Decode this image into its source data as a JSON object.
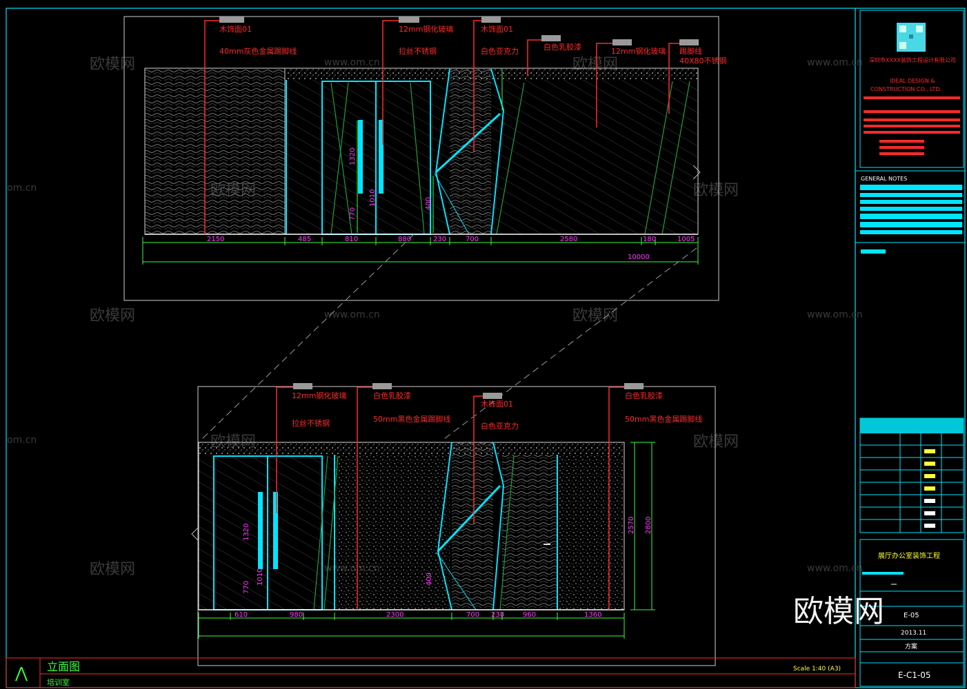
{
  "colors": {
    "background": "#000000",
    "frame": "#00e5ff",
    "annotation": "#ff2a2a",
    "dimension": "#39ff39",
    "dim_text": "#ff3cff",
    "tag": "#bdbdbd"
  },
  "watermarks": {
    "brand": "欧模网",
    "site": "www.om.cn",
    "site_short": "om.cn",
    "overlay": "欧模网"
  },
  "upper_elevation": {
    "callouts": [
      {
        "line1": "木饰面01",
        "line2": "40mm灰色金属踢脚线"
      },
      {
        "line1": "12mm钢化玻璃",
        "line2": "拉丝不锈钢"
      },
      {
        "line1": "木饰面01",
        "line2": "白色亚克力"
      },
      {
        "line1": "白色乳胶漆",
        "line2": ""
      },
      {
        "line1": "12mm钢化玻璃",
        "line2": ""
      },
      {
        "line1": "踢脚线",
        "line2": "40X80不锈钢"
      }
    ],
    "dims": [
      "2150",
      "485",
      "810",
      "880",
      "230",
      "700",
      "2580",
      "180",
      "1005"
    ],
    "total": "10000",
    "vertical_dims": [
      "1320",
      "770",
      "400",
      "1010"
    ]
  },
  "lower_elevation": {
    "callouts": [
      {
        "line1": "12mm钢化玻璃",
        "line2": "拉丝不锈钢"
      },
      {
        "line1": "白色乳胶漆",
        "line2": "50mm黑色金属踢脚线"
      },
      {
        "line1": "木饰面01",
        "line2": "白色亚克力"
      },
      {
        "line1": "白色乳胶漆",
        "line2": "50mm黑色金属踢脚线"
      }
    ],
    "dims": [
      "610",
      "980",
      "2300",
      "700",
      "230",
      "960",
      "1360"
    ],
    "vertical_dims": [
      "2570",
      "2800",
      "1320",
      "770",
      "1010",
      "400"
    ]
  },
  "title_strip": {
    "title": "立面图",
    "subtitle": "培训室",
    "scale": "Scale 1:40 (A3)"
  },
  "title_block": {
    "company_cn": "深圳市XXXX装饰工程设计有限公司",
    "company_en_1": "IDEAL DESIGN &",
    "company_en_2": "CONSTRUCTION CO., LTD.",
    "notes_heading": "GENERAL NOTES",
    "project_name": "展厅办公室装饰工程",
    "drawing_no": "E-C1-05",
    "sheet_code": "E-05",
    "date": "2013.11",
    "status": "方案"
  }
}
